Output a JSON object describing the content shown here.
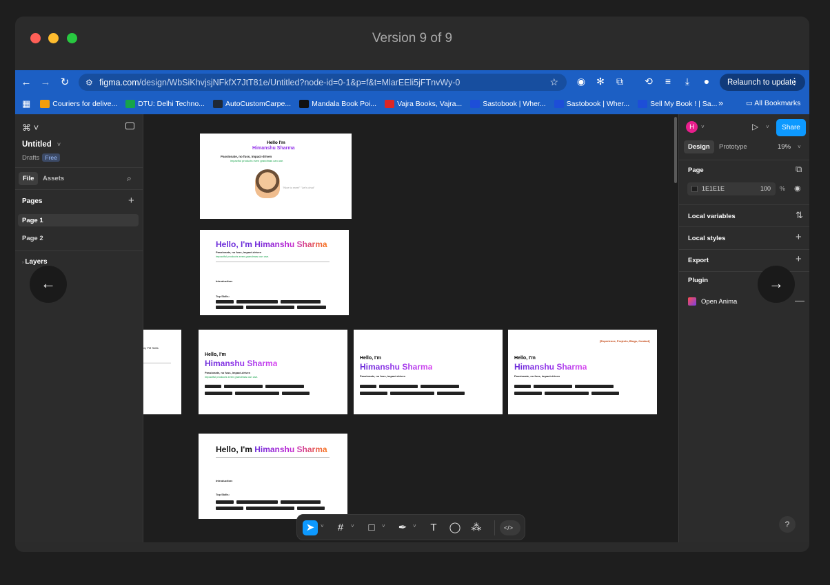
{
  "window": {
    "title": "Version 9 of 9"
  },
  "browser": {
    "url_domain": "figma.com",
    "url_rest": "/design/WbSiKhvjsjNFkfX7JtT81e/Untitled?node-id=0-1&p=f&t=MlarEEli5jFTnvWy-0",
    "relaunch_label": "Relaunch to update",
    "bookmarks": [
      {
        "label": "Couriers for delive...",
        "color": "#f59e0b"
      },
      {
        "label": "DTU: Delhi Techno...",
        "color": "#16a34a"
      },
      {
        "label": "AutoCustomCarpe...",
        "color": "#1f2937"
      },
      {
        "label": "Mandala Book Poi...",
        "color": "#111111"
      },
      {
        "label": "Vajra Books, Vajra...",
        "color": "#dc2626"
      },
      {
        "label": "Sastobook | Wher...",
        "color": "#1d4ed8"
      },
      {
        "label": "Sastobook | Wher...",
        "color": "#1d4ed8"
      },
      {
        "label": "Sell My Book ! | Sa...",
        "color": "#1d4ed8"
      }
    ],
    "bm_icons": [
      "SB"
    ],
    "all_bookmarks": "All Bookmarks"
  },
  "figma": {
    "file_title": "Untitled",
    "drafts": "Drafts",
    "free_badge": "Free",
    "tabs": {
      "file": "File",
      "assets": "Assets"
    },
    "pages_header": "Pages",
    "pages": [
      "Page 1",
      "Page 2"
    ],
    "layers_header": "Layers",
    "right": {
      "avatar_initial": "H",
      "share": "Share",
      "tab_design": "Design",
      "tab_prototype": "Prototype",
      "zoom": "19%",
      "page_header": "Page",
      "bg_hex": "1E1E1E",
      "bg_opacity": "100",
      "percent": "%",
      "local_variables": "Local variables",
      "local_styles": "Local styles",
      "export": "Export",
      "plugin": "Plugin",
      "plugin_name": "Open Anima",
      "help": "?"
    },
    "canvas_frames": {
      "hello_im": "Hello I'm",
      "hello_im_comma": "Hello, I'm",
      "name": "Himanshu Sharma",
      "hello_full": "Hello, I'm Himanshu Sharma",
      "tagline_bold": "Passionate, no fuss, impact-driven",
      "tagline": "Product Manager blending technical precision and data insights to build",
      "tagline_link": "impactful products even grandmas can use.",
      "intro_label": "Introduction:",
      "top_skills": "Top Skills:",
      "nav_links": "[Experience, Projects, Blogs, Contact]",
      "fragment": "ny PM Skills"
    }
  }
}
